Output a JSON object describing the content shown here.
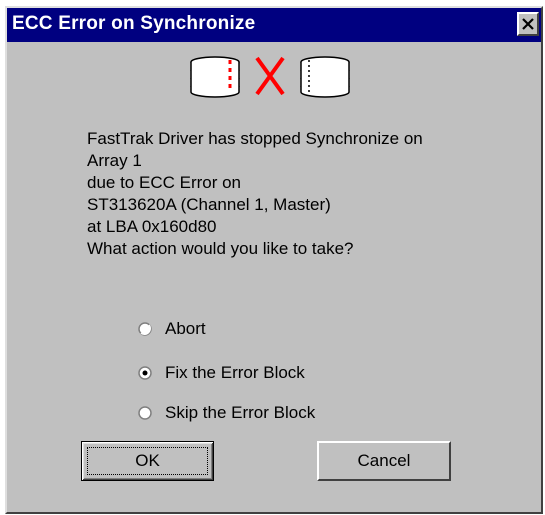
{
  "dialog": {
    "title": "ECC Error on Synchronize",
    "close_label": "✕",
    "icon": "disk-array-error-icon",
    "message_lines": [
      "FastTrak Driver has stopped Synchronize on",
      "Array 1",
      "due to ECC Error on",
      "ST313620A (Channel 1, Master)",
      "at LBA 0x160d80",
      "What action would you like to take?"
    ],
    "options": [
      {
        "label": "Abort",
        "selected": false
      },
      {
        "label": "Fix the Error Block",
        "selected": true
      },
      {
        "label": "Skip the Error Block",
        "selected": false
      }
    ],
    "ok_label": "OK",
    "cancel_label": "Cancel"
  },
  "colors": {
    "titlebar": "#000080",
    "face": "#c0c0c0",
    "error_red": "#ff0000"
  }
}
